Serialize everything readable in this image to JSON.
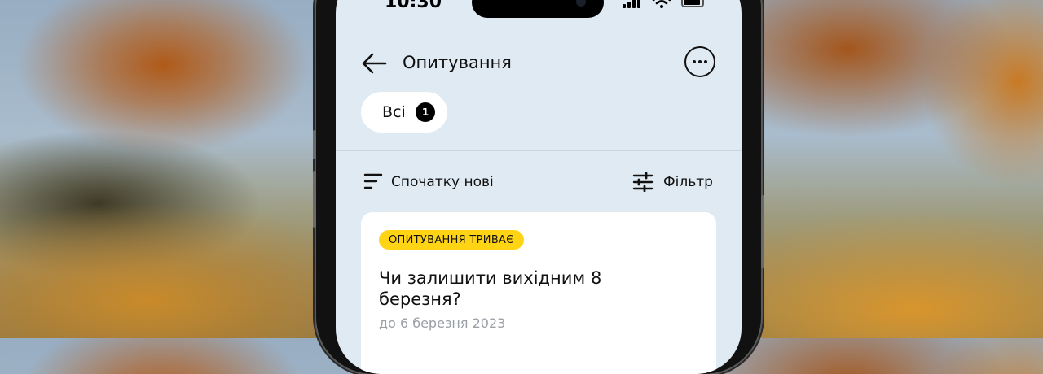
{
  "status_bar": {
    "time": "10:30"
  },
  "header": {
    "title": "Опитування"
  },
  "filter_chips": [
    {
      "label": "Всі",
      "count": "1"
    }
  ],
  "toolbar": {
    "sort_label": "Спочатку нові",
    "filter_label": "Фільтр"
  },
  "polls": [
    {
      "status_badge": "ОПИТУВАННЯ ТРИВАЄ",
      "title": "Чи залишити вихідним 8 березня?",
      "deadline": "до 6 березня 2023"
    }
  ],
  "colors": {
    "screen_bg": "#e0eaf3",
    "badge_yellow": "#ffd415",
    "card_bg": "#ffffff"
  },
  "icons": [
    "back-arrow-icon",
    "more-options-icon",
    "sort-icon",
    "filter-sliders-icon",
    "signal-icon",
    "wifi-icon",
    "battery-icon"
  ]
}
